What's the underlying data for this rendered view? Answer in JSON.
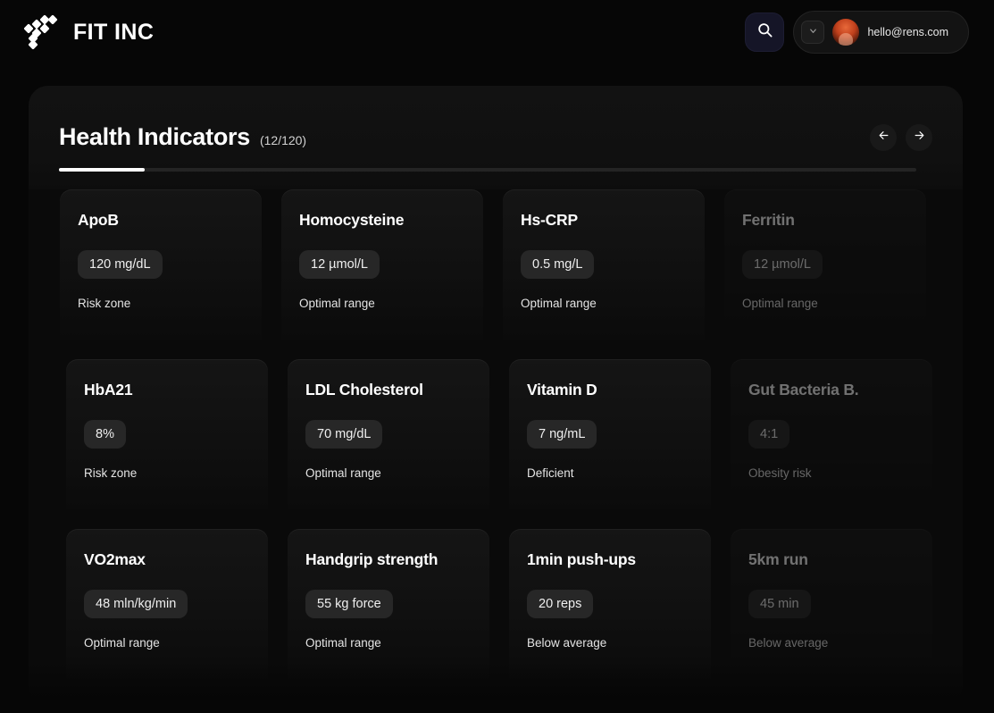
{
  "header": {
    "brand_name": "FIT INC",
    "logo_icon": "pixel-diamond-logo",
    "search_icon": "search-icon",
    "chevron_icon": "chevron-down-icon",
    "avatar_icon": "user-avatar",
    "user_email": "hello@rens.com"
  },
  "panel": {
    "title": "Health Indicators",
    "count": "(12/120)",
    "prev_icon": "arrow-left-icon",
    "next_icon": "arrow-right-icon",
    "progress_percent": 10
  },
  "rows": [
    {
      "cards": [
        {
          "title": "ApoB",
          "value": "120 mg/dL",
          "status": "Risk zone",
          "dim": false
        },
        {
          "title": "Homocysteine",
          "value": "12 µmol/L",
          "status": "Optimal range",
          "dim": false
        },
        {
          "title": "Hs-CRP",
          "value": "0.5 mg/L",
          "status": "Optimal range",
          "dim": false
        },
        {
          "title": "Ferritin",
          "value": "12 µmol/L",
          "status": "Optimal range",
          "dim": true
        }
      ]
    },
    {
      "cards": [
        {
          "title": "HbA21",
          "value": "8%",
          "status": "Risk zone",
          "dim": false
        },
        {
          "title": "LDL Cholesterol",
          "value": "70 mg/dL",
          "status": "Optimal range",
          "dim": false
        },
        {
          "title": "Vitamin D",
          "value": "7 ng/mL",
          "status": "Deficient",
          "dim": false
        },
        {
          "title": "Gut Bacteria B.",
          "value": "4:1",
          "status": "Obesity risk",
          "dim": true
        }
      ]
    },
    {
      "cards": [
        {
          "title": "VO2max",
          "value": "48 mln/kg/min",
          "status": "Optimal range",
          "dim": false
        },
        {
          "title": "Handgrip strength",
          "value": "55 kg force",
          "status": "Optimal range",
          "dim": false
        },
        {
          "title": "1min push-ups",
          "value": "20 reps",
          "status": "Below average",
          "dim": false
        },
        {
          "title": "5km run",
          "value": "45 min",
          "status": "Below average",
          "dim": true
        }
      ]
    }
  ],
  "colors": {
    "page_bg": "#060606",
    "panel_bg": "#0a0a0a",
    "card_bg": "#131313",
    "pill_bg": "#272727",
    "accent": "#ffffff",
    "search_bg": "#151527"
  }
}
